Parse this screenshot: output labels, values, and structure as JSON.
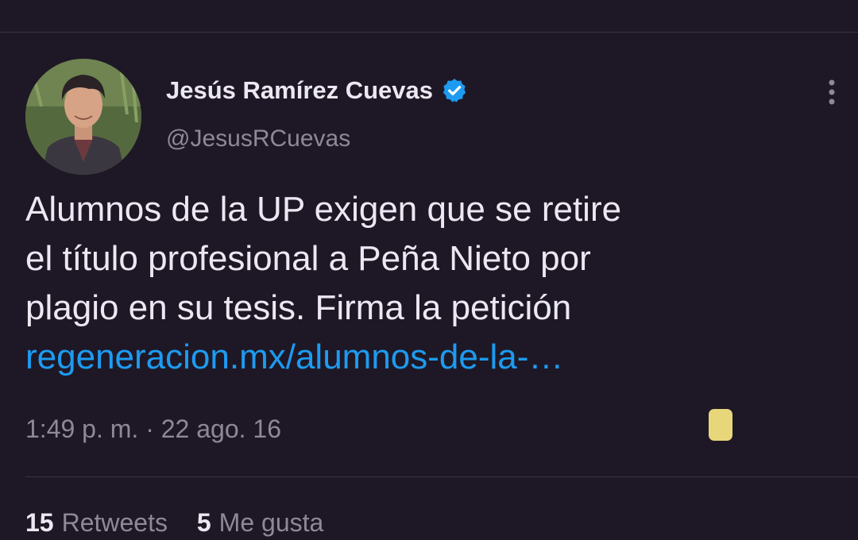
{
  "author": {
    "display_name": "Jesús Ramírez Cuevas",
    "handle": "@JesusRCuevas",
    "verified": true
  },
  "tweet": {
    "text_lines": [
      "Alumnos de la UP exigen que se retire",
      "el título profesional a Peña Nieto por",
      "plagio en su tesis. Firma la petición"
    ],
    "link_text": "regeneracion.mx/alumnos-de-la-…",
    "timestamp": "1:49 p. m. · 22 ago. 16"
  },
  "stats": {
    "retweets_count": "15",
    "retweets_label": "Retweets",
    "likes_count": "5",
    "likes_label": "Me gusta"
  },
  "icons": {
    "verified": "verified-badge-icon",
    "more": "more-options-icon"
  },
  "colors": {
    "background": "#1e1826",
    "link": "#1d9bf0",
    "verified": "#1d9bf0",
    "secondary_text": "#8f8897",
    "primary_text": "#ece8f2"
  }
}
